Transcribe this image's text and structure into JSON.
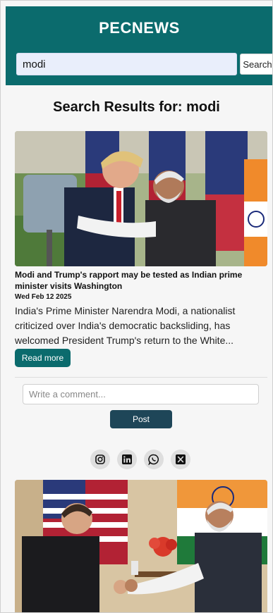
{
  "header": {
    "brand": "PECNEWS",
    "search_value": "modi",
    "search_button": "Search"
  },
  "results": {
    "title": "Search Results for: modi"
  },
  "articles": [
    {
      "title": "Modi and Trump's rapport may be tested as Indian prime minister visits Washington",
      "date": "Wed Feb 12 2025",
      "summary": "India's Prime Minister Narendra Modi, a nationalist criticized over India's democratic backsliding, has welcomed President Trump's return to the White...",
      "read_more": "Read more"
    }
  ],
  "comment": {
    "placeholder": "Write a comment...",
    "post_label": "Post"
  },
  "social": [
    {
      "icon": "instagram-icon",
      "glyph": "◎"
    },
    {
      "icon": "linkedin-icon",
      "glyph": "in"
    },
    {
      "icon": "whatsapp-icon",
      "glyph": "✆"
    },
    {
      "icon": "x-icon",
      "glyph": "X"
    }
  ],
  "colors": {
    "brand": "#0b6b6d",
    "post_button": "#1e4658"
  }
}
